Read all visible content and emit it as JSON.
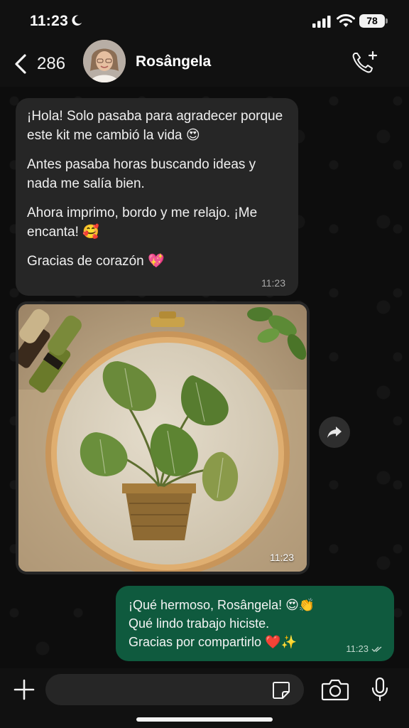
{
  "status_bar": {
    "time": "11:23",
    "battery": "78",
    "icons": [
      "moon-icon",
      "signal-icon",
      "wifi-icon",
      "battery-icon"
    ]
  },
  "header": {
    "back_count": "286",
    "contact_name": "Rosângela",
    "icons": [
      "back-chevron-icon",
      "avatar",
      "add-call-icon"
    ]
  },
  "messages": {
    "incoming": {
      "paragraphs": [
        "¡Hola! Solo pasaba para agradecer porque este kit me cambió la vida 😍",
        "Antes pasaba horas buscando ideas y nada me salía bien.",
        "Ahora imprimo, bordo y me relajo. ¡Me encanta! 🥰",
        "Gracias de corazón 💖"
      ],
      "time": "11:23"
    },
    "image": {
      "time": "11:23",
      "description_icon": "embroidery-photo"
    },
    "outgoing": {
      "lines": [
        "¡Qué hermoso, Rosângela! 😍👏",
        "Qué lindo trabajo hiciste.",
        "Gracias por compartirlo ❤️✨"
      ],
      "time": "11:23",
      "status_icon": "double-check-icon"
    }
  },
  "input_bar": {
    "placeholder": "",
    "icons": [
      "plus-icon",
      "sticker-icon",
      "camera-icon",
      "mic-icon"
    ]
  },
  "colors": {
    "incoming_bubble": "#262626",
    "outgoing_bubble": "#0f5a3e",
    "background": "#0b0b0b"
  }
}
